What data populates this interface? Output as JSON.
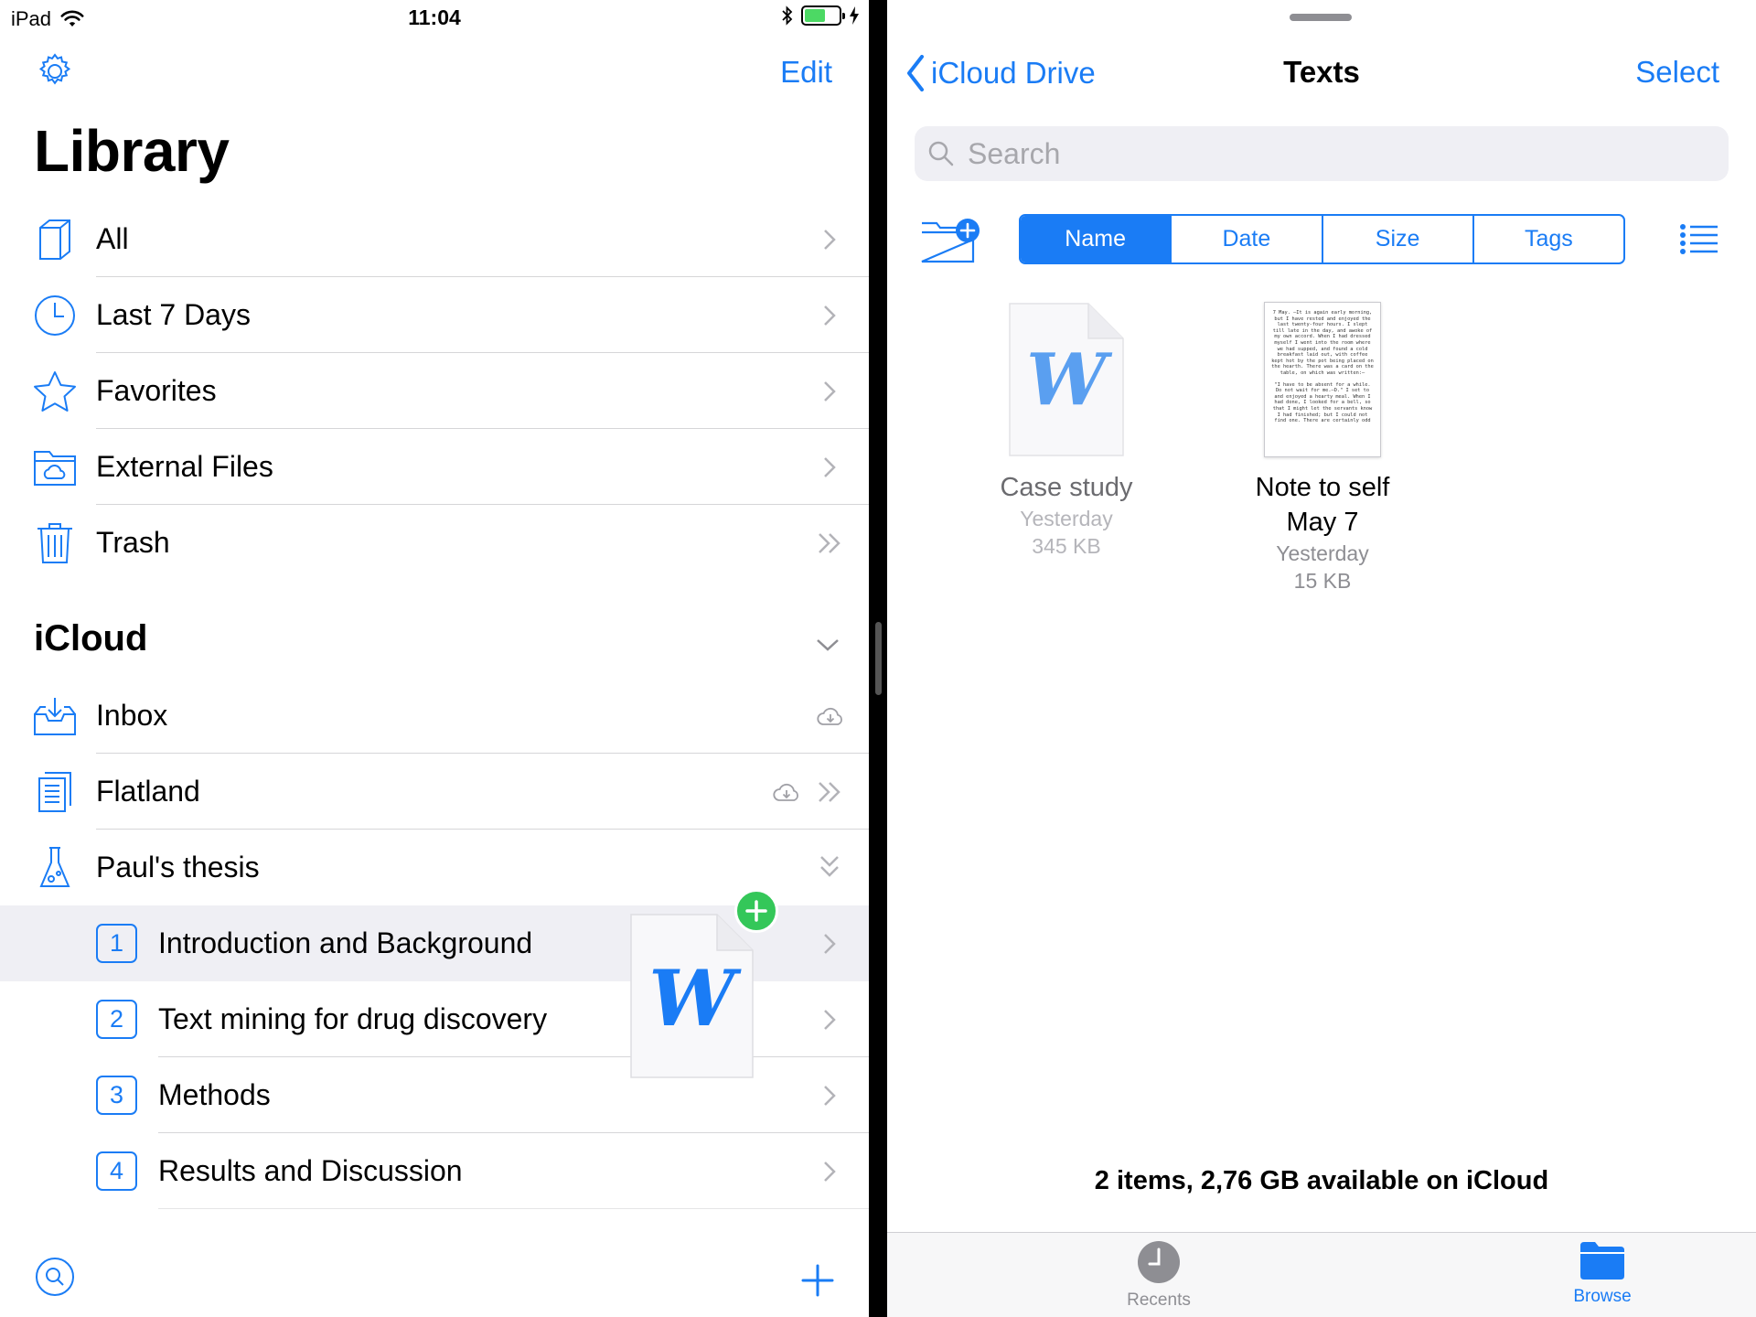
{
  "status": {
    "device": "iPad",
    "time": "11:04"
  },
  "library": {
    "edit_label": "Edit",
    "title": "Library",
    "items": [
      {
        "label": "All"
      },
      {
        "label": "Last 7 Days"
      },
      {
        "label": "Favorites"
      },
      {
        "label": "External Files"
      },
      {
        "label": "Trash"
      }
    ]
  },
  "icloud": {
    "title": "iCloud",
    "items": [
      {
        "label": "Inbox"
      },
      {
        "label": "Flatland"
      },
      {
        "label": "Paul's thesis"
      }
    ],
    "chapters": [
      {
        "num": "1",
        "label": "Introduction and Background"
      },
      {
        "num": "2",
        "label": "Text mining for drug discovery"
      },
      {
        "num": "3",
        "label": "Methods"
      },
      {
        "num": "4",
        "label": "Results and Discussion"
      }
    ]
  },
  "drag_icon_letter": "W",
  "browser": {
    "back_label": "iCloud Drive",
    "title": "Texts",
    "select_label": "Select",
    "search_placeholder": "Search",
    "sort_tabs": [
      {
        "label": "Name",
        "active": true
      },
      {
        "label": "Date"
      },
      {
        "label": "Size"
      },
      {
        "label": "Tags"
      }
    ],
    "files": [
      {
        "name": "Case study",
        "date": "Yesterday",
        "size": "345 KB",
        "thumb_letter": "W"
      },
      {
        "name": "Note to self\nMay 7",
        "name_line1": "Note to self",
        "name_line2": "May 7",
        "date": "Yesterday",
        "size": "15 KB",
        "preview_p1": "7 May. —It is again early morning, but I have rested and enjoyed the last twenty-four hours. I slept till late in the day, and awoke of my own accord. When I had dressed myself I went into the room where we had supped, and found a cold breakfast laid out, with coffee kept hot by the pot being placed on the hearth. There was a card on the table, on which was written:—",
        "preview_p2": "\"I have to be absent for a while. Do not wait for me.—D.\" I set to and enjoyed a hearty meal. When I had done, I looked for a bell, so that I might let the servants know I had finished; but I could not find one. There are certainly odd"
      }
    ],
    "footer": "2 items, 2,76 GB available on iCloud",
    "tabs": [
      {
        "label": "Recents"
      },
      {
        "label": "Browse"
      }
    ]
  },
  "colors": {
    "accent": "#1a7cf5",
    "add_badge": "#34c759",
    "selected_row": "#efeff4"
  }
}
